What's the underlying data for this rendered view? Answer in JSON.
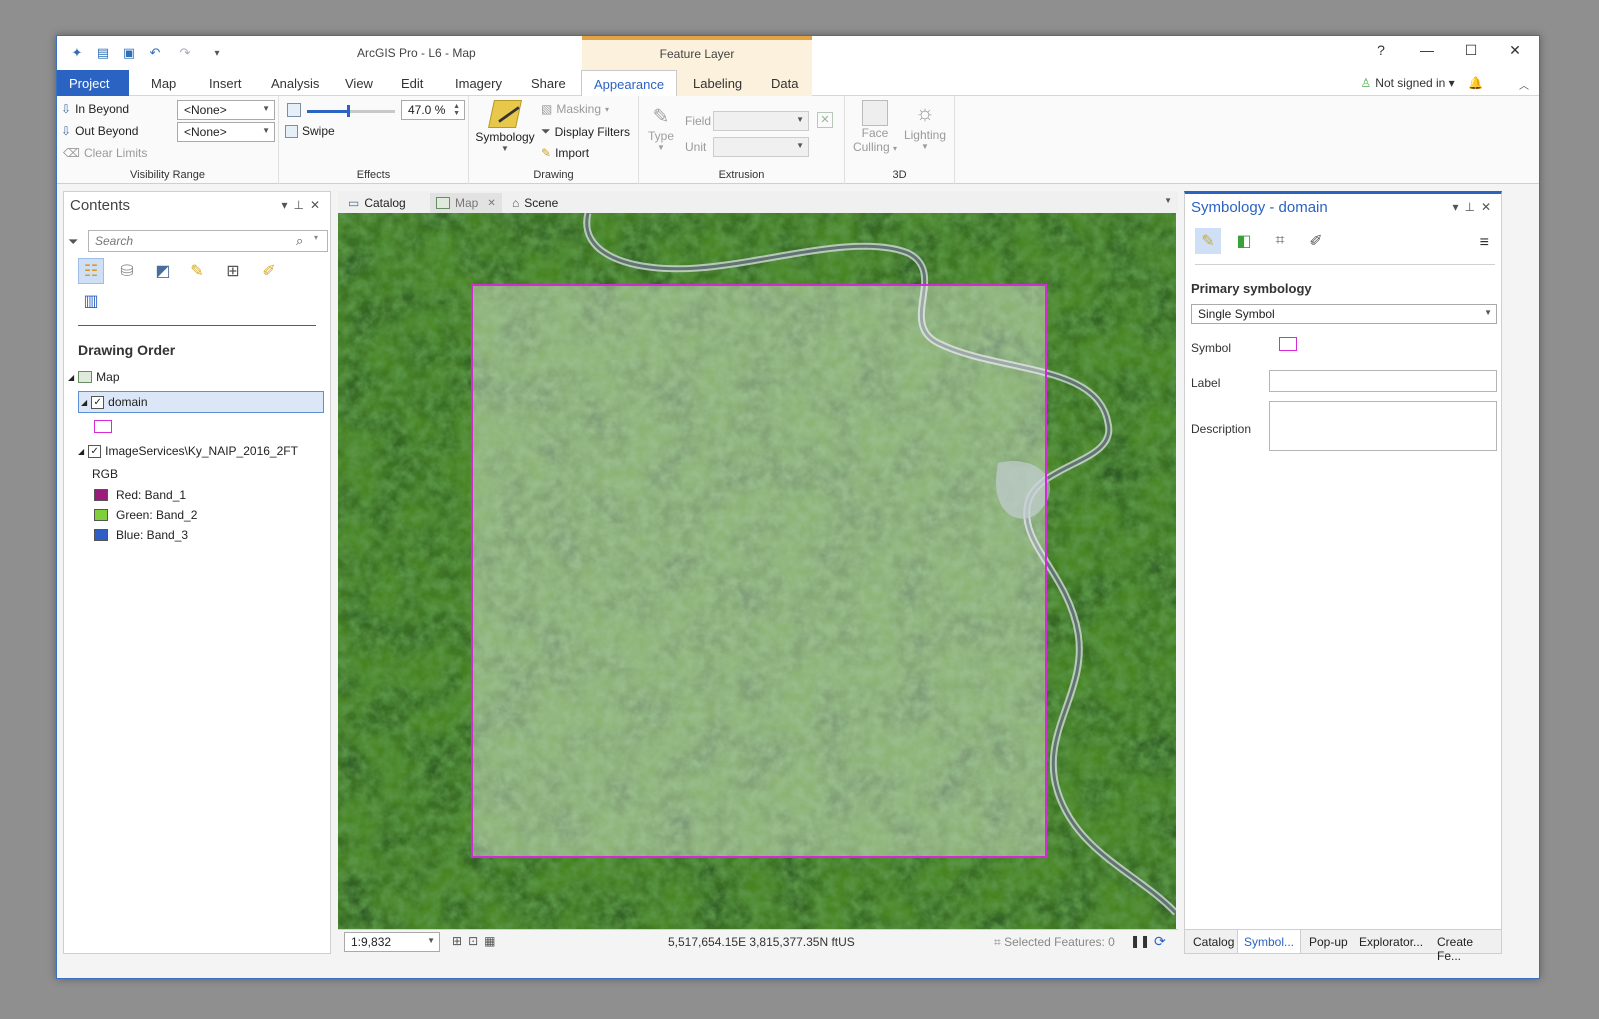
{
  "window": {
    "title": "ArcGIS Pro - L6 - Map",
    "contextual_header": "Feature Layer",
    "controls": {
      "help": "?",
      "minimize": "—",
      "maximize": "☐",
      "close": "✕"
    }
  },
  "quick_access": [
    "new-icon",
    "open-icon",
    "save-icon",
    "undo-icon",
    "redo-icon",
    "customize-icon"
  ],
  "tabs": [
    {
      "label": "Project"
    },
    {
      "label": "Map"
    },
    {
      "label": "Insert"
    },
    {
      "label": "Analysis"
    },
    {
      "label": "View"
    },
    {
      "label": "Edit"
    },
    {
      "label": "Imagery"
    },
    {
      "label": "Share"
    },
    {
      "label": "Appearance"
    },
    {
      "label": "Labeling"
    },
    {
      "label": "Data"
    }
  ],
  "signin": {
    "label": "Not signed in ▾"
  },
  "ribbon": {
    "visibility": {
      "in_beyond": "In Beyond",
      "out_beyond": "Out Beyond",
      "clear_limits": "Clear Limits",
      "in_value": "<None>",
      "out_value": "<None>",
      "group_label": "Visibility Range"
    },
    "effects": {
      "transparency": "47.0 %",
      "transparency_level": 0.47,
      "swipe": "Swipe",
      "group_label": "Effects"
    },
    "drawing": {
      "symbology": "Symbology",
      "masking": "Masking",
      "display_filters": "Display Filters",
      "import": "Import",
      "group_label": "Drawing"
    },
    "extrusion": {
      "type": "Type",
      "field": "Field",
      "unit": "Unit",
      "group_label": "Extrusion"
    },
    "threed": {
      "face_culling_1": "Face",
      "face_culling_2": "Culling",
      "lighting": "Lighting",
      "group_label": "3D"
    }
  },
  "contents": {
    "title": "Contents",
    "search_placeholder": "Search",
    "drawing_order": "Drawing Order",
    "map_label": "Map",
    "layers": [
      {
        "name": "domain",
        "checked": true
      },
      {
        "name": "ImageServices\\Ky_NAIP_2016_2FT",
        "checked": true
      }
    ],
    "rgb_label": "RGB",
    "bands": [
      {
        "label": "Red:   Band_1",
        "color": "#9b1b7a"
      },
      {
        "label": "Green:  Band_2",
        "color": "#7fce3a"
      },
      {
        "label": "Blue:  Band_3",
        "color": "#2f5fc4"
      }
    ]
  },
  "views": {
    "tabs": [
      {
        "label": "Catalog"
      },
      {
        "label": "Map"
      },
      {
        "label": "Scene"
      }
    ]
  },
  "statusbar": {
    "scale": "1:9,832",
    "coords": "5,517,654.15E 3,815,377.35N ftUS",
    "selected": "Selected Features: 0"
  },
  "symbology": {
    "title": "Symbology - domain",
    "primary_symbology": "Primary symbology",
    "renderer": "Single Symbol",
    "symbol_label": "Symbol",
    "label_label": "Label",
    "label_value": "",
    "description_label": "Description",
    "description_value": "",
    "bottom_tabs": [
      "Catalog",
      "Symbol...",
      "Pop-up",
      "Explorator...",
      "Create Fe..."
    ]
  },
  "colors": {
    "accent": "#2b63c2",
    "polygon_outline": "#d62ad8",
    "contextual": "#e3a243"
  }
}
